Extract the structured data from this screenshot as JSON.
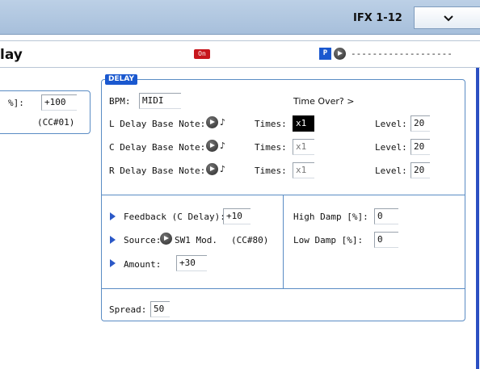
{
  "header": {
    "ifx_label": "IFX 1-12",
    "select_icon": "chevron-down-icon"
  },
  "title_bar": {
    "title": "lay",
    "on_badge": "On",
    "p_badge": "P",
    "dashes": "-------------------"
  },
  "left_panel": {
    "label": "%]:",
    "value": "+100",
    "cc": "(CC#01)"
  },
  "delay": {
    "section_label": "DELAY",
    "bpm_label": "BPM:",
    "bpm_value": "MIDI",
    "time_over": "Time Over? >",
    "rows": [
      {
        "label": "L Delay Base Note:",
        "note": "♪",
        "times_label": "Times:",
        "times_value": "x1",
        "level_label": "Level:",
        "level_value": "20"
      },
      {
        "label": "C Delay Base Note:",
        "note": "♪",
        "times_label": "Times:",
        "times_value": "x1",
        "level_label": "Level:",
        "level_value": "20"
      },
      {
        "label": "R Delay Base Note:",
        "note": "♪",
        "times_label": "Times:",
        "times_value": "x1",
        "level_label": "Level:",
        "level_value": "20"
      }
    ],
    "feedback_label": "Feedback (C Delay):",
    "feedback_value": "+10",
    "source_label": "Source:",
    "source_value": "SW1 Mod.",
    "source_cc": "(CC#80)",
    "amount_label": "Amount:",
    "amount_value": "+30",
    "high_damp_label": "High Damp [%]:",
    "high_damp_value": "0",
    "low_damp_label": "Low Damp [%]:",
    "low_damp_value": "0",
    "spread_label": "Spread:",
    "spread_value": "50"
  }
}
